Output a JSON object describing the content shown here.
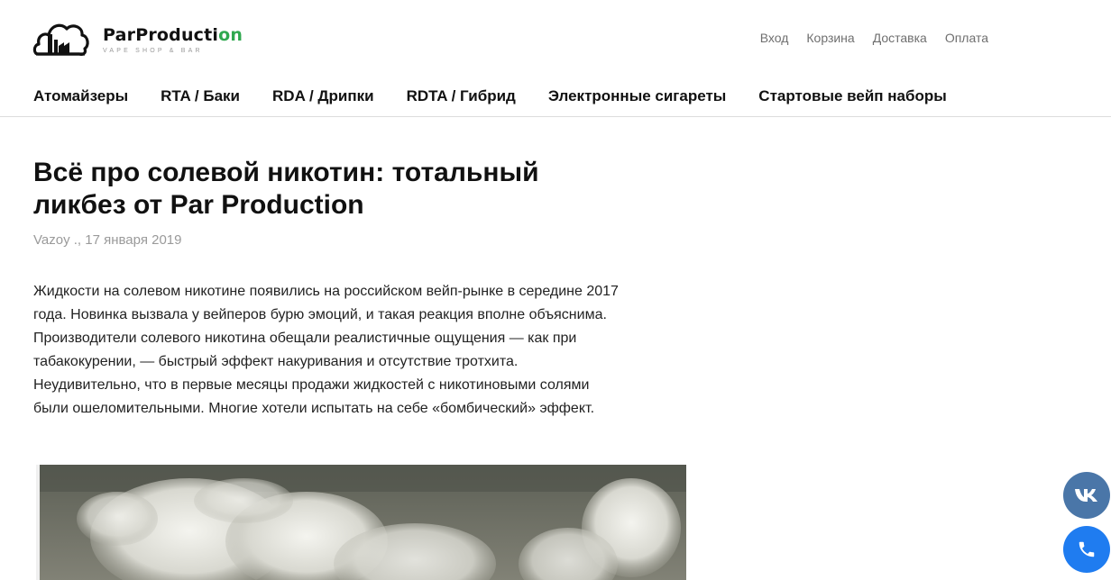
{
  "header": {
    "logo": {
      "name_main": "ParProducti",
      "name_accent": "on",
      "tagline": "VAPE SHOP & BAR"
    },
    "top_links": [
      "Вход",
      "Корзина",
      "Доставка",
      "Оплата"
    ],
    "nav": [
      "Атомайзеры",
      "RTA / Баки",
      "RDA / Дрипки",
      "RDTA / Гибрид",
      "Электронные сигареты",
      "Стартовые вейп наборы"
    ]
  },
  "article": {
    "title": "Всё про солевой никотин: тотальный ликбез от Par Production",
    "meta": "Vazoy ., 17 января 2019",
    "paragraph": "Жидкости на солевом никотине появились на российском вейп-рынке в середине 2017 года. Новинка вызвала у вейперов бурю эмоций, и такая реакция вполне объяснима. Производители солевого никотина обещали реалистичные ощущения — как при табакокурении, — быстрый эффект накуривания и отсутствие тротхита. Неудивительно, что в первые месяцы продажи жидкостей с никотиновыми солями были ошеломительными. Многие хотели испытать на себе «бомбический» эффект."
  },
  "floating_buttons": {
    "vk": "vk-icon",
    "phone": "phone-icon"
  },
  "colors": {
    "accent_green": "#2fa84f",
    "vk_blue": "#4a76a8",
    "phone_blue": "#1f7cf0",
    "muted_text": "#9a9a9a"
  }
}
